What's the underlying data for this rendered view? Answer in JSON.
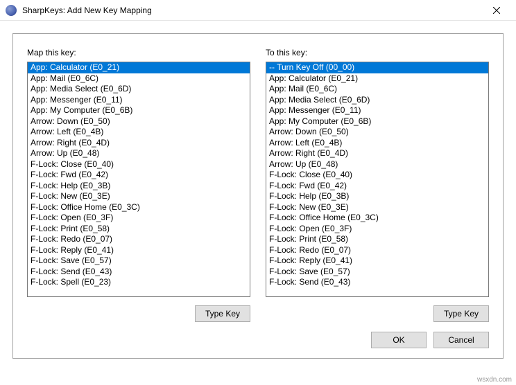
{
  "window": {
    "title": "SharpKeys: Add New Key Mapping"
  },
  "left": {
    "label": "Map this key:",
    "selected_index": 0,
    "items": [
      "App: Calculator (E0_21)",
      "App: Mail (E0_6C)",
      "App: Media Select (E0_6D)",
      "App: Messenger (E0_11)",
      "App: My Computer (E0_6B)",
      "Arrow: Down (E0_50)",
      "Arrow: Left (E0_4B)",
      "Arrow: Right (E0_4D)",
      "Arrow: Up (E0_48)",
      "F-Lock: Close (E0_40)",
      "F-Lock: Fwd (E0_42)",
      "F-Lock: Help (E0_3B)",
      "F-Lock: New (E0_3E)",
      "F-Lock: Office Home (E0_3C)",
      "F-Lock: Open (E0_3F)",
      "F-Lock: Print (E0_58)",
      "F-Lock: Redo (E0_07)",
      "F-Lock: Reply (E0_41)",
      "F-Lock: Save (E0_57)",
      "F-Lock: Send (E0_43)",
      "F-Lock: Spell (E0_23)"
    ],
    "type_key_label": "Type Key"
  },
  "right": {
    "label": "To this key:",
    "selected_index": 0,
    "items": [
      "-- Turn Key Off (00_00)",
      "App: Calculator (E0_21)",
      "App: Mail (E0_6C)",
      "App: Media Select (E0_6D)",
      "App: Messenger (E0_11)",
      "App: My Computer (E0_6B)",
      "Arrow: Down (E0_50)",
      "Arrow: Left (E0_4B)",
      "Arrow: Right (E0_4D)",
      "Arrow: Up (E0_48)",
      "F-Lock: Close (E0_40)",
      "F-Lock: Fwd (E0_42)",
      "F-Lock: Help (E0_3B)",
      "F-Lock: New (E0_3E)",
      "F-Lock: Office Home (E0_3C)",
      "F-Lock: Open (E0_3F)",
      "F-Lock: Print (E0_58)",
      "F-Lock: Redo (E0_07)",
      "F-Lock: Reply (E0_41)",
      "F-Lock: Save (E0_57)",
      "F-Lock: Send (E0_43)"
    ],
    "type_key_label": "Type Key"
  },
  "footer": {
    "ok": "OK",
    "cancel": "Cancel"
  },
  "watermark": "wsxdn.com"
}
